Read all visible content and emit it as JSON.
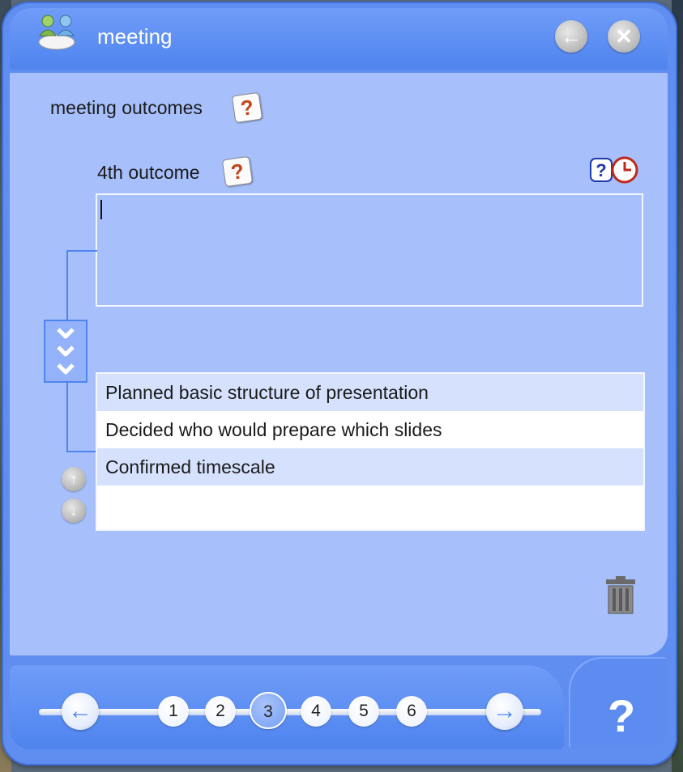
{
  "window": {
    "title": "meeting",
    "back_icon": "arrow-left-icon",
    "close_icon": "close-icon"
  },
  "section": {
    "heading": "meeting outcomes",
    "field_label": "4th outcome",
    "textarea_value": ""
  },
  "outcomes_list": {
    "items": [
      "Planned basic structure of presentation",
      "Decided who would prepare which slides",
      "Confirmed timescale",
      ""
    ]
  },
  "pager": {
    "pages": [
      "1",
      "2",
      "3",
      "4",
      "5",
      "6"
    ],
    "current": "3"
  },
  "help_corner": "?",
  "help_mark": "?",
  "colors": {
    "window_blue": "#5f8df0",
    "panel_blue": "#a7c0fb",
    "row_highlight": "#d6e2fd"
  }
}
